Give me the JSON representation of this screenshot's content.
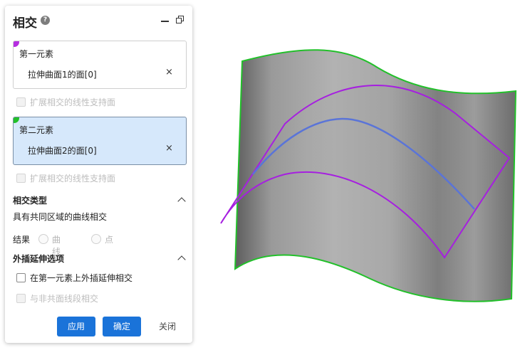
{
  "dialog": {
    "title": "相交",
    "help_icon": "?",
    "first_element": {
      "label": "第一元素",
      "value": "拉伸曲面1的面[0]",
      "close": "×",
      "accent_color": "#b52ee0"
    },
    "extend_linear_1": "扩展相交的线性支持面",
    "second_element": {
      "label": "第二元素",
      "value": "拉伸曲面2的面[0]",
      "close": "×",
      "accent_color": "#22c02a"
    },
    "extend_linear_2": "扩展相交的线性支持面",
    "intersection_type": {
      "title": "相交类型",
      "value": "具有共同区域的曲线相交"
    },
    "result": {
      "label": "结果",
      "options": [
        "曲线",
        "点"
      ]
    },
    "extrapolation": {
      "title": "外插延伸选项",
      "option_1": "在第一元素上外插延伸相交",
      "option_2": "与非共面线段相交"
    },
    "buttons": {
      "apply": "应用",
      "ok": "确定",
      "close": "关闭"
    }
  },
  "colors": {
    "primary_button": "#1a73d9",
    "active_box": "#d6e8fb",
    "surface_1_edge": "#22c02a",
    "surface_2_edge": "#a61fe0",
    "intersection_curve": "#5a74d8"
  }
}
